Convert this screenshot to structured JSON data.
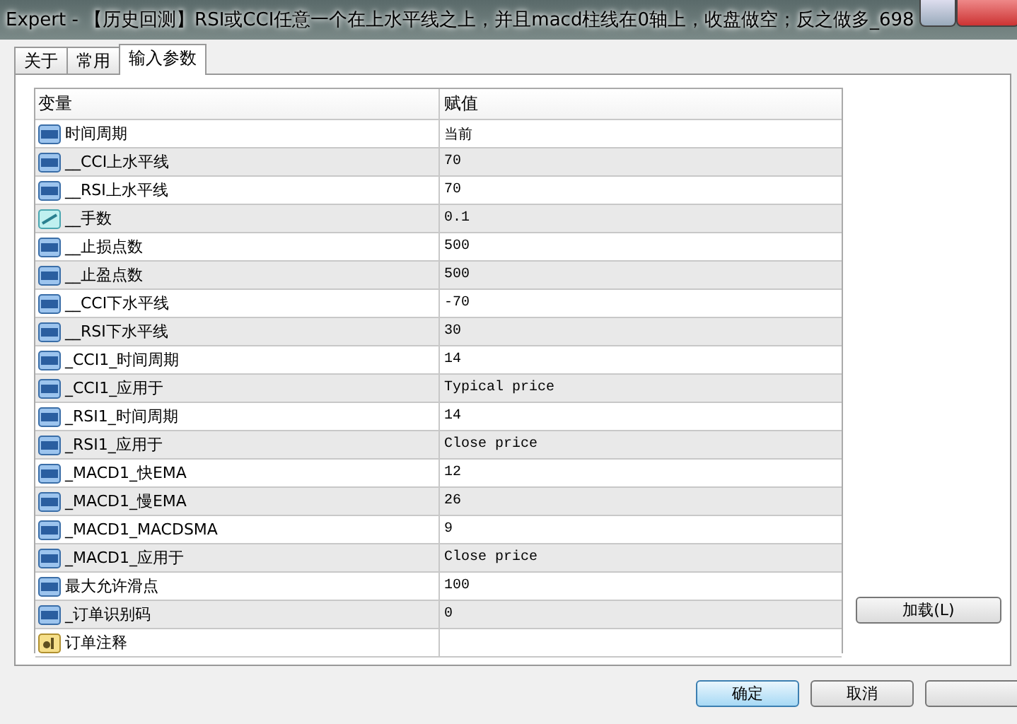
{
  "window": {
    "title": "Expert - 【历史回测】RSI或CCI任意一个在上水平线之上，并且macd柱线在0轴上，收盘做空；反之做多_698"
  },
  "tabs": [
    {
      "label": "关于",
      "selected": false
    },
    {
      "label": "常用",
      "selected": false
    },
    {
      "label": "输入参数",
      "selected": true
    }
  ],
  "table": {
    "columns": [
      "变量",
      "赋值"
    ],
    "rows": [
      {
        "kind": "int",
        "name": "时间周期",
        "value": "当前"
      },
      {
        "kind": "int",
        "name": "__CCI上水平线",
        "value": "70"
      },
      {
        "kind": "int",
        "name": "__RSI上水平线",
        "value": "70"
      },
      {
        "kind": "double",
        "name": "__手数",
        "value": "0.1"
      },
      {
        "kind": "int",
        "name": "__止损点数",
        "value": "500"
      },
      {
        "kind": "int",
        "name": "__止盈点数",
        "value": "500"
      },
      {
        "kind": "int",
        "name": "__CCI下水平线",
        "value": "-70"
      },
      {
        "kind": "int",
        "name": "__RSI下水平线",
        "value": "30"
      },
      {
        "kind": "int",
        "name": "_CCI1_时间周期",
        "value": "14"
      },
      {
        "kind": "int",
        "name": "_CCI1_应用于",
        "value": "Typical price"
      },
      {
        "kind": "int",
        "name": "_RSI1_时间周期",
        "value": "14"
      },
      {
        "kind": "int",
        "name": "_RSI1_应用于",
        "value": "Close price"
      },
      {
        "kind": "int",
        "name": "_MACD1_快EMA",
        "value": "12"
      },
      {
        "kind": "int",
        "name": "_MACD1_慢EMA",
        "value": "26"
      },
      {
        "kind": "int",
        "name": "_MACD1_MACDSMA",
        "value": "9"
      },
      {
        "kind": "int",
        "name": "_MACD1_应用于",
        "value": "Close price"
      },
      {
        "kind": "int",
        "name": "最大允许滑点",
        "value": "100"
      },
      {
        "kind": "int",
        "name": "_订单识别码",
        "value": "0"
      },
      {
        "kind": "string",
        "name": "订单注释"
      }
    ]
  },
  "side_buttons": [
    "加载(L)"
  ],
  "buttons": [
    {
      "label": "确定",
      "default": true
    },
    {
      "label": "取消",
      "default": false
    },
    {
      "default": false
    }
  ]
}
